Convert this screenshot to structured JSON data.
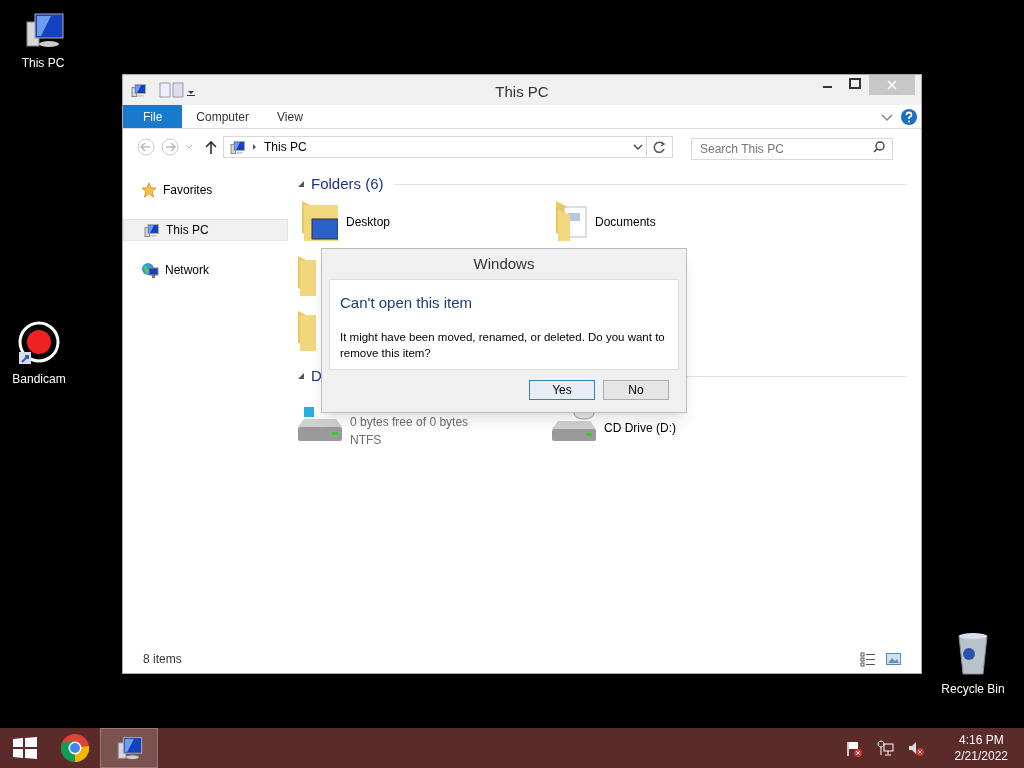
{
  "desktop_icons": [
    {
      "label": "This PC",
      "kind": "pc"
    },
    {
      "label": "Bandicam",
      "kind": "bandicam"
    },
    {
      "label": "Recycle Bin",
      "kind": "bin"
    }
  ],
  "window": {
    "title": "This PC",
    "ribbon_tabs": [
      {
        "label": "File",
        "selected": true
      },
      {
        "label": "Computer",
        "selected": false
      },
      {
        "label": "View",
        "selected": false
      }
    ],
    "address": "This PC",
    "search": {
      "placeholder": "Search This PC"
    },
    "nav": [
      {
        "label": "Favorites",
        "kind": "star",
        "selected": false
      },
      {
        "label": "This PC",
        "kind": "pc",
        "selected": true
      },
      {
        "label": "Network",
        "kind": "network",
        "selected": false
      }
    ],
    "groups": [
      {
        "title": "Folders (6)",
        "items": [
          {
            "label": "Desktop",
            "kind": "desktop"
          },
          {
            "label": "Documents",
            "kind": "documents"
          },
          {
            "kind": "folder"
          },
          {
            "kind": "folder"
          }
        ]
      },
      {
        "title": "D",
        "items": [
          {
            "kind": "local",
            "details": [
              "0 bytes free of 0 bytes",
              "NTFS"
            ]
          },
          {
            "kind": "cd",
            "label": "CD Drive (D:)"
          }
        ]
      }
    ],
    "status_bar": "8 items"
  },
  "dialog": {
    "title": "Windows",
    "heading": "Can't open this item",
    "message": "It might have been moved, renamed, or deleted. Do you want to remove this item?",
    "buttons": [
      {
        "label": "Yes",
        "default": true
      },
      {
        "label": "No",
        "default": false
      }
    ]
  },
  "taskbar": {
    "apps": [
      {
        "kind": "start",
        "active": false
      },
      {
        "kind": "chrome",
        "active": false
      },
      {
        "kind": "pc",
        "active": true
      }
    ],
    "time": "4:16 PM",
    "date": "2/21/2022"
  }
}
